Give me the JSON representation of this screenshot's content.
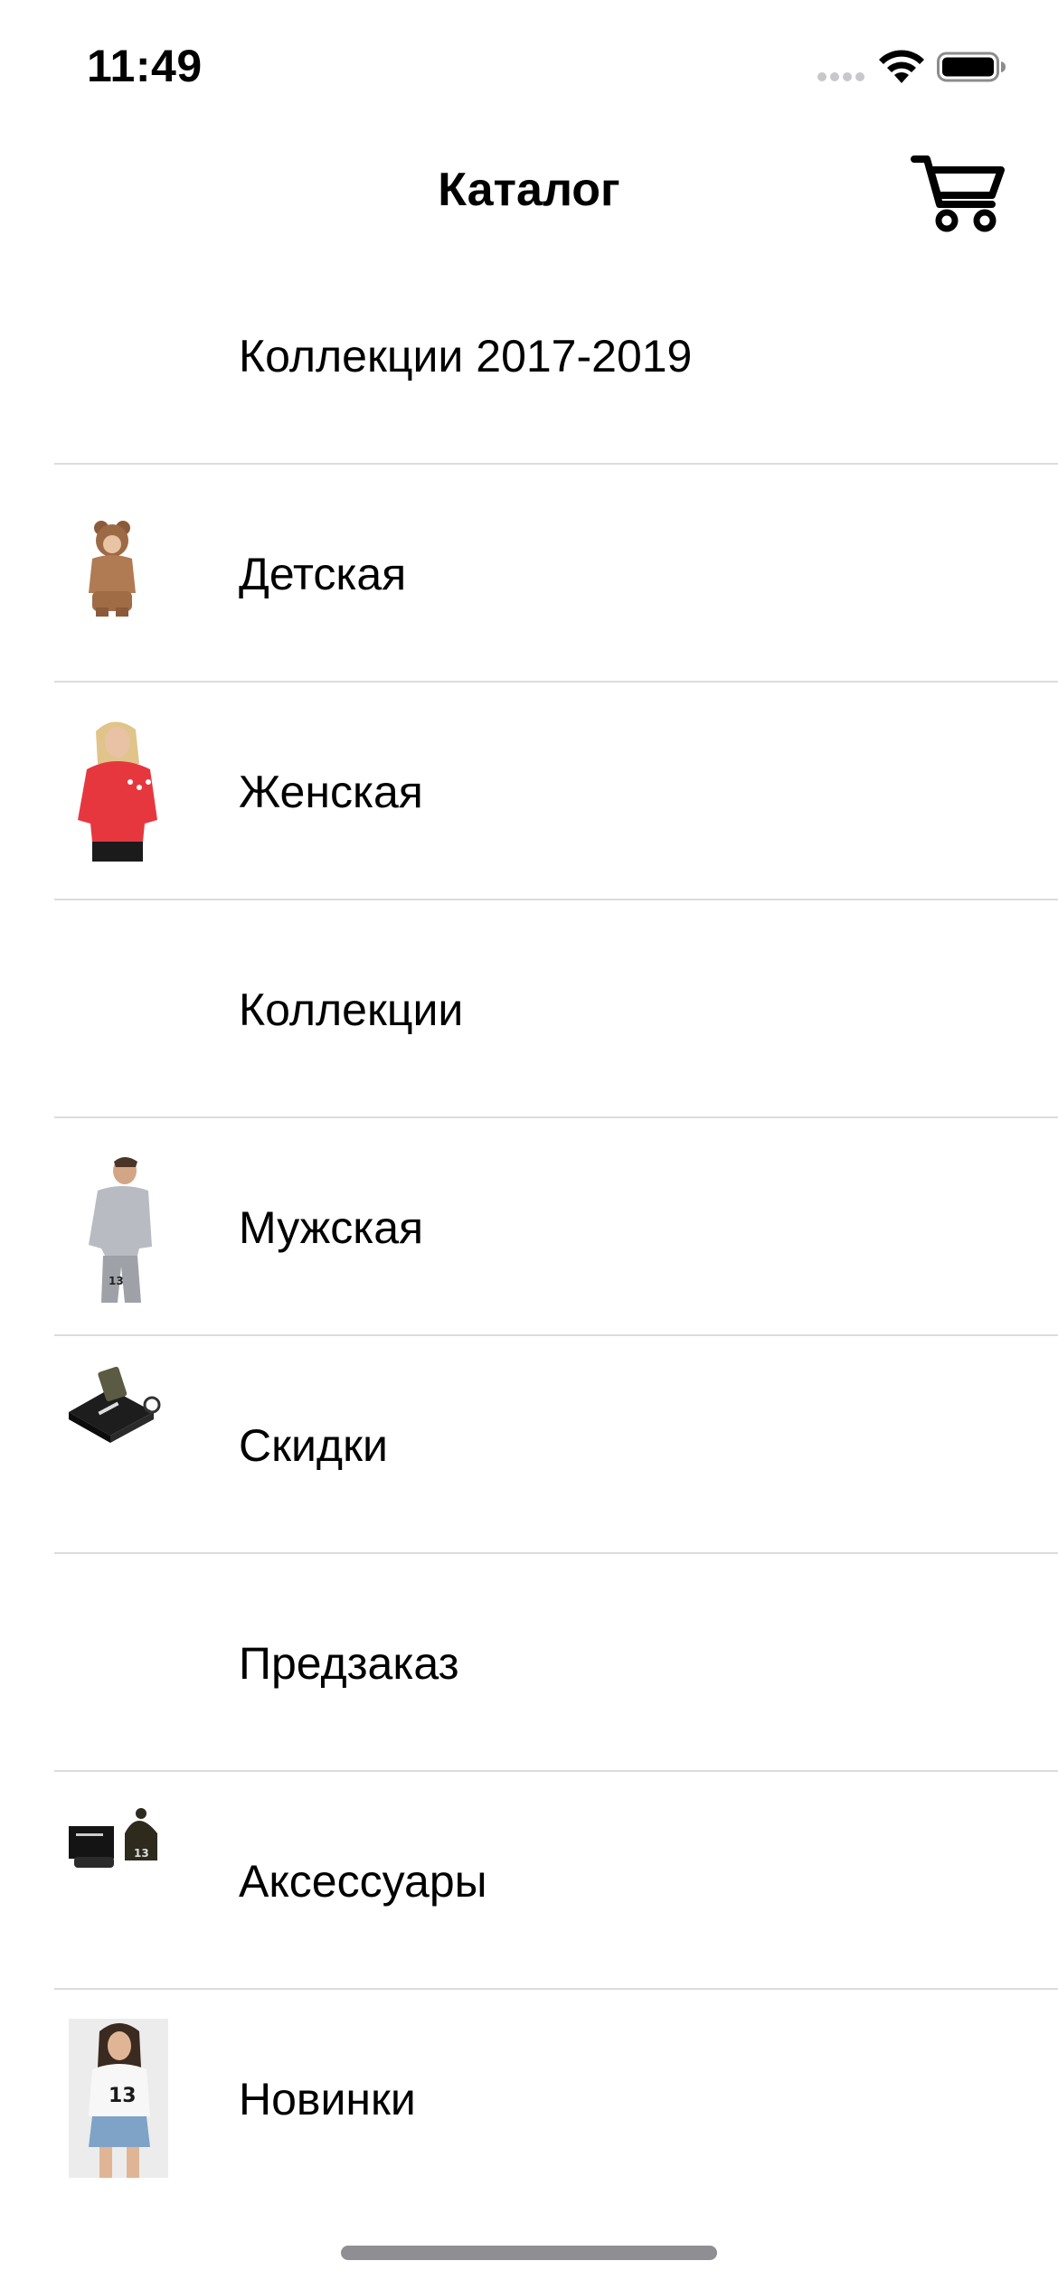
{
  "status_bar": {
    "time": "11:49",
    "icons": [
      "signal-dots-icon",
      "wifi-icon",
      "battery-icon"
    ]
  },
  "nav": {
    "title": "Каталог",
    "cart_icon": "shopping-cart-icon"
  },
  "catalog": {
    "items": [
      {
        "label": "Коллекции 2017-2019",
        "thumbnail": "none"
      },
      {
        "label": "Детская",
        "thumbnail": "kids-hoodie-photo"
      },
      {
        "label": "Женская",
        "thumbnail": "women-red-sweatshirt-photo"
      },
      {
        "label": "Коллекции",
        "thumbnail": "none"
      },
      {
        "label": "Мужская",
        "thumbnail": "men-grey-tracksuit-photo"
      },
      {
        "label": "Скидки",
        "thumbnail": "gift-box-set-photo"
      },
      {
        "label": "Предзаказ",
        "thumbnail": "none"
      },
      {
        "label": "Аксессуары",
        "thumbnail": "beanie-accessories-photo"
      },
      {
        "label": "Новинки",
        "thumbnail": "woman-tshirt-13-photo"
      }
    ]
  },
  "colors": {
    "separator": "#dcdcdf",
    "text": "#000000",
    "background": "#ffffff",
    "home_indicator": "#8e8e93"
  }
}
